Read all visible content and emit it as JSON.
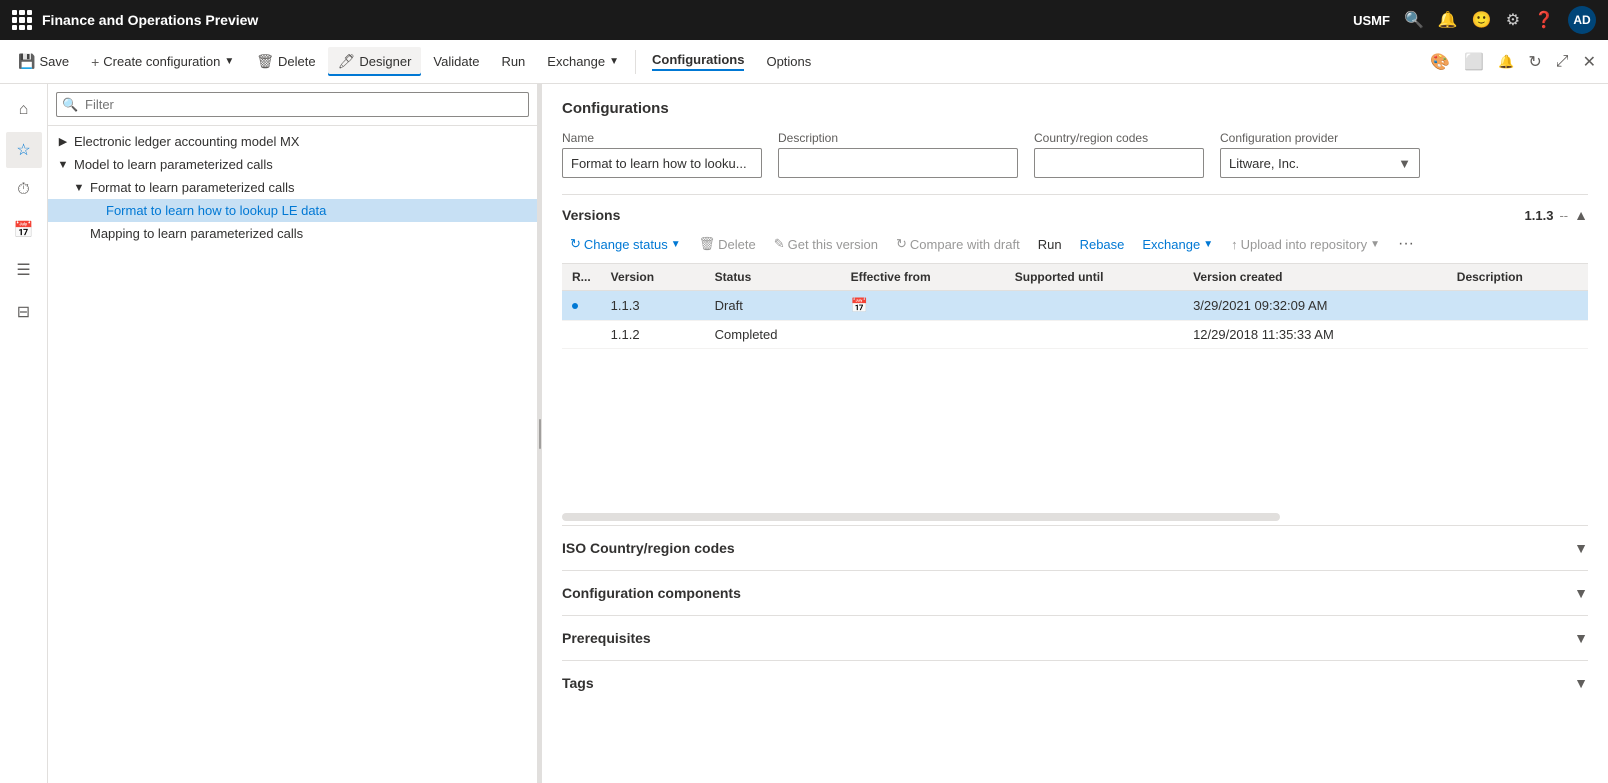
{
  "titleBar": {
    "appTitle": "Finance and Operations Preview",
    "userRegion": "USMF",
    "avatarText": "AD"
  },
  "commandBar": {
    "saveLabel": "Save",
    "createConfigLabel": "Create configuration",
    "deleteLabel": "Delete",
    "designerLabel": "Designer",
    "validateLabel": "Validate",
    "runLabel": "Run",
    "exchangeLabel": "Exchange",
    "configurationsLabel": "Configurations",
    "optionsLabel": "Options"
  },
  "filter": {
    "placeholder": "Filter"
  },
  "treeItems": [
    {
      "id": "electronic-ledger",
      "label": "Electronic ledger accounting model MX",
      "level": 0,
      "toggle": "▶",
      "expanded": false,
      "selected": false
    },
    {
      "id": "model-parameterized",
      "label": "Model to learn parameterized calls",
      "level": 0,
      "toggle": "▼",
      "expanded": true,
      "selected": false
    },
    {
      "id": "format-parameterized",
      "label": "Format to learn parameterized calls",
      "level": 1,
      "toggle": "▼",
      "expanded": true,
      "selected": false
    },
    {
      "id": "format-lookup",
      "label": "Format to learn how to lookup LE data",
      "level": 2,
      "toggle": "",
      "expanded": false,
      "selected": true
    },
    {
      "id": "mapping-parameterized",
      "label": "Mapping to learn parameterized calls",
      "level": 1,
      "toggle": "",
      "expanded": false,
      "selected": false
    }
  ],
  "mainContent": {
    "pageTitle": "Configurations",
    "formFields": {
      "nameLabel": "Name",
      "nameValue": "Format to learn how to looku...",
      "descLabel": "Description",
      "descValue": "",
      "countryLabel": "Country/region codes",
      "countryValue": "",
      "providerLabel": "Configuration provider",
      "providerValue": "Litware, Inc."
    },
    "versions": {
      "sectionTitle": "Versions",
      "versionNumber": "1.1.3",
      "versionDash": "--",
      "toolbar": {
        "changeStatusLabel": "Change status",
        "deleteLabel": "Delete",
        "getThisVersionLabel": "Get this version",
        "compareWithDraftLabel": "Compare with draft",
        "runLabel": "Run",
        "rebaseLabel": "Rebase",
        "exchangeLabel": "Exchange",
        "uploadIntoRepositoryLabel": "Upload into repository"
      },
      "tableHeaders": [
        "R...",
        "Version",
        "Status",
        "Effective from",
        "Supported until",
        "Version created",
        "Description"
      ],
      "rows": [
        {
          "indicator": true,
          "version": "1.1.3",
          "status": "Draft",
          "effectiveFrom": "",
          "supportedUntil": "",
          "versionCreated": "3/29/2021 09:32:09 AM",
          "description": "",
          "selected": true
        },
        {
          "indicator": false,
          "version": "1.1.2",
          "status": "Completed",
          "effectiveFrom": "",
          "supportedUntil": "",
          "versionCreated": "12/29/2018 11:35:33 AM",
          "description": "",
          "selected": false
        }
      ]
    },
    "collapsibleSections": [
      {
        "id": "iso-country",
        "label": "ISO Country/region codes"
      },
      {
        "id": "config-components",
        "label": "Configuration components"
      },
      {
        "id": "prerequisites",
        "label": "Prerequisites"
      },
      {
        "id": "tags",
        "label": "Tags"
      }
    ]
  }
}
